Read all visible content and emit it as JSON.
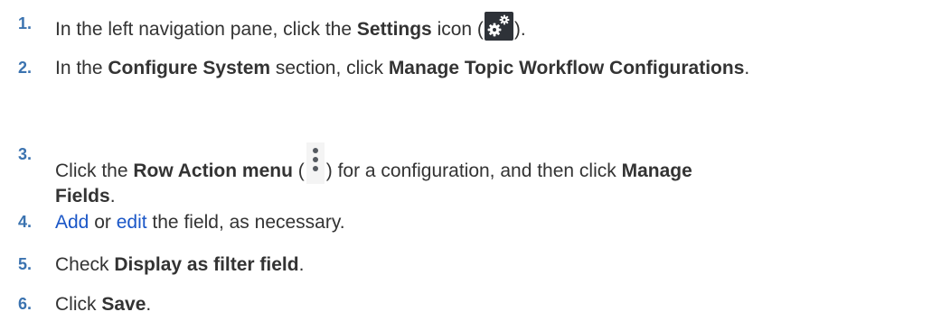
{
  "steps": [
    {
      "number": "1.",
      "before": "In the left navigation pane, click the ",
      "bold": "Settings",
      "after_bold": " icon (",
      "icon": "settings-gear-icon",
      "after": ")."
    },
    {
      "number": "2.",
      "before": "In the ",
      "bold1": "Configure System",
      "middle": " section, click ",
      "bold2": "Manage Topic Workflow Configurations",
      "after": "."
    },
    {
      "number": "3.",
      "before": "Click the ",
      "bold1": "Row Action menu",
      "after_bold1": " (",
      "icon": "row-action-kebab-icon",
      "middle": ") for a configuration, and then click ",
      "bold2": "Manage",
      "line2_bold": "Fields",
      "after": "."
    },
    {
      "number": "4.",
      "link1": "Add",
      "between": " or ",
      "link2": "edit",
      "after": " the field, as necessary."
    },
    {
      "number": "5.",
      "before": "Check ",
      "bold": "Display as filter field",
      "after": "."
    },
    {
      "number": "6.",
      "before": "Click ",
      "bold": "Save",
      "after": "."
    }
  ]
}
